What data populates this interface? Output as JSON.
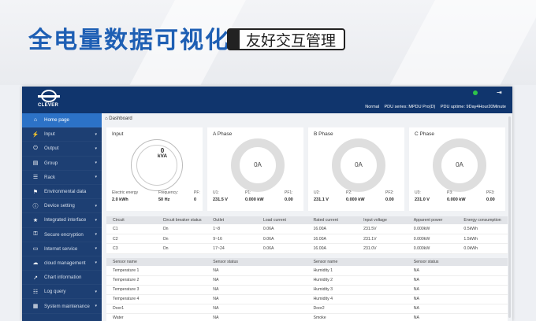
{
  "banner": {
    "title": "全电量数据可视化",
    "tag": "友好交互管理"
  },
  "header": {
    "logo_text": "CLEVER",
    "logout_icon": "logout-icon",
    "status": {
      "mode": "Normal",
      "series": "PDU series: MPDU Pro(D)",
      "uptime": "PDU uptime: 9Day4Hour20Minute"
    }
  },
  "sidebar": {
    "items": [
      {
        "label": "Home page",
        "icon": "home-icon",
        "active": true,
        "caret": false
      },
      {
        "label": "Input",
        "icon": "lightning-icon",
        "caret": true
      },
      {
        "label": "Output",
        "icon": "power-icon",
        "caret": true
      },
      {
        "label": "Group",
        "icon": "group-icon",
        "caret": true
      },
      {
        "label": "Rack",
        "icon": "rack-icon",
        "caret": true
      },
      {
        "label": "Environmental data",
        "icon": "flag-icon",
        "caret": false
      },
      {
        "label": "Device setting",
        "icon": "info-icon",
        "caret": true
      },
      {
        "label": "Integrated interface",
        "icon": "star-icon",
        "caret": true
      },
      {
        "label": "Secure encryption",
        "icon": "lock-icon",
        "caret": true
      },
      {
        "label": "Internet service",
        "icon": "monitor-icon",
        "caret": true
      },
      {
        "label": "cloud management",
        "icon": "cloud-icon",
        "caret": true
      },
      {
        "label": "Chart information",
        "icon": "chart-icon",
        "caret": false
      },
      {
        "label": "Log query",
        "icon": "document-icon",
        "caret": true
      },
      {
        "label": "System maintenance",
        "icon": "grid-icon",
        "caret": true
      }
    ]
  },
  "breadcrumb": "Dashboard",
  "input_card": {
    "title": "Input",
    "value": "0",
    "unit": "kVA",
    "metrics": [
      {
        "label": "Electric energy",
        "value": "2.0 kWh"
      },
      {
        "label": "Frequency:",
        "value": "50 Hz"
      },
      {
        "label": "PF:",
        "value": "0"
      }
    ]
  },
  "phases": [
    {
      "title": "A Phase",
      "current": "0A",
      "metrics": [
        {
          "label": "U1:",
          "value": "231.5 V"
        },
        {
          "label": "P1:",
          "value": "0.000 kW"
        },
        {
          "label": "PF1:",
          "value": "0.00"
        }
      ]
    },
    {
      "title": "B Phase",
      "current": "0A",
      "metrics": [
        {
          "label": "U2:",
          "value": "231.1 V"
        },
        {
          "label": "P2:",
          "value": "0.000 kW"
        },
        {
          "label": "PF2:",
          "value": "0.00"
        }
      ]
    },
    {
      "title": "C Phase",
      "current": "0A",
      "metrics": [
        {
          "label": "U3:",
          "value": "231.0 V"
        },
        {
          "label": "P3:",
          "value": "0.000 kW"
        },
        {
          "label": "PF3:",
          "value": "0.00"
        }
      ]
    }
  ],
  "circuit_table": {
    "headers": [
      "Circuit",
      "Circuit breaker status",
      "Outlet",
      "Load current",
      "Rated current",
      "Input voltage",
      "Apparent power",
      "Energy consumption"
    ],
    "rows": [
      [
        "C1",
        "On",
        "1~8",
        "0.06A",
        "16.00A",
        "231.5V",
        "0.000kW",
        "0.5kWh"
      ],
      [
        "C2",
        "On",
        "9~16",
        "0.06A",
        "16.00A",
        "231.1V",
        "0.000kW",
        "1.5kWh"
      ],
      [
        "C3",
        "On",
        "17~24",
        "0.06A",
        "16.00A",
        "231.0V",
        "0.000kW",
        "0.0kWh"
      ]
    ]
  },
  "sensor_table": {
    "headers": [
      "Sensor name",
      "Sensor status",
      "Sensor name",
      "Sensor status"
    ],
    "rows": [
      [
        "Temperature 1",
        "NA",
        "Humidity 1",
        "NA"
      ],
      [
        "Temperature 2",
        "NA",
        "Humidity 2",
        "NA"
      ],
      [
        "Temperature 3",
        "NA",
        "Humidity 3",
        "NA"
      ],
      [
        "Temperature 4",
        "NA",
        "Humidity 4",
        "NA"
      ],
      [
        "Door1",
        "NA",
        "Door2",
        "NA"
      ],
      [
        "Water",
        "NA",
        "Smoke",
        "NA"
      ]
    ]
  }
}
